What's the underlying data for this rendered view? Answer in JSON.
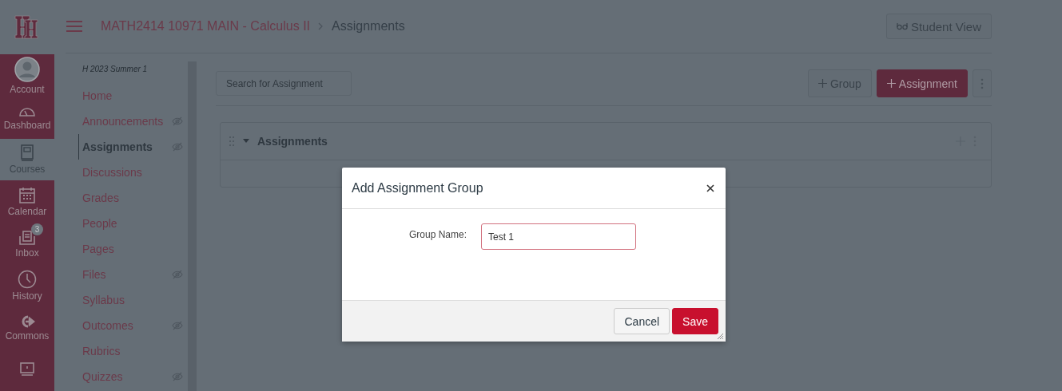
{
  "global_nav": {
    "items": [
      {
        "label": "Account",
        "kind": "account",
        "selected": false
      },
      {
        "label": "Dashboard",
        "kind": "dashboard",
        "selected": false
      },
      {
        "label": "Courses",
        "kind": "courses",
        "selected": true
      },
      {
        "label": "Calendar",
        "kind": "calendar",
        "selected": false
      },
      {
        "label": "Inbox",
        "kind": "inbox",
        "selected": false,
        "badge": "3"
      },
      {
        "label": "History",
        "kind": "history",
        "selected": false
      },
      {
        "label": "Commons",
        "kind": "commons",
        "selected": false
      },
      {
        "kind": "studio",
        "selected": false
      }
    ]
  },
  "header": {
    "breadcrumb": [
      {
        "label": "MATH2414 10971 MAIN - Calculus II"
      },
      {
        "label": "Assignments"
      }
    ],
    "student_view_button": "Student View"
  },
  "course_nav": {
    "term": "H 2023 Summer 1",
    "items": [
      {
        "label": "Home",
        "selected": false,
        "hidden": false
      },
      {
        "label": "Announcements",
        "selected": false,
        "hidden": true
      },
      {
        "label": "Assignments",
        "selected": true,
        "hidden": true
      },
      {
        "label": "Discussions",
        "selected": false,
        "hidden": false
      },
      {
        "label": "Grades",
        "selected": false,
        "hidden": false
      },
      {
        "label": "People",
        "selected": false,
        "hidden": false
      },
      {
        "label": "Pages",
        "selected": false,
        "hidden": false
      },
      {
        "label": "Files",
        "selected": false,
        "hidden": true
      },
      {
        "label": "Syllabus",
        "selected": false,
        "hidden": false
      },
      {
        "label": "Outcomes",
        "selected": false,
        "hidden": true
      },
      {
        "label": "Rubrics",
        "selected": false,
        "hidden": false
      },
      {
        "label": "Quizzes",
        "selected": false,
        "hidden": true
      }
    ]
  },
  "toolbar": {
    "search": {
      "placeholder": "Search for Assignment"
    },
    "group_button": "Group",
    "assignment_button": "Assignment"
  },
  "assignment_group": {
    "title": "Assignments",
    "expanded": true
  },
  "dialog": {
    "title": "Add Assignment Group",
    "field_label": "Group Name:",
    "field_value": "Test 1",
    "cancel_button": "Cancel",
    "save_button": "Save"
  }
}
